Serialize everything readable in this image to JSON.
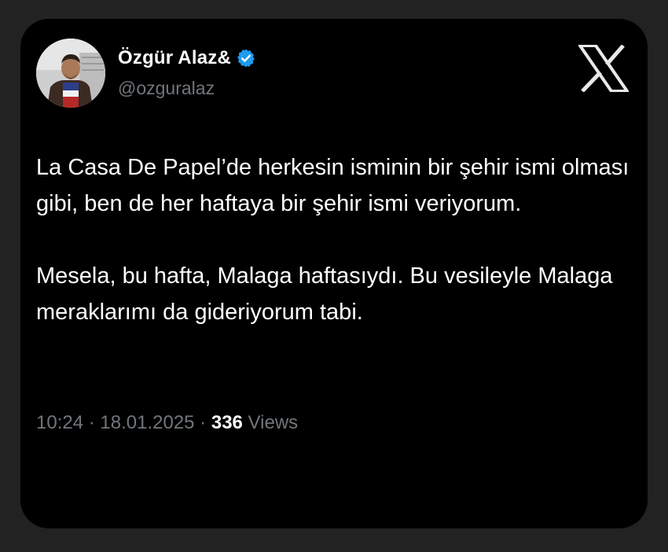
{
  "author": {
    "display_name": "Özgür Alaz&",
    "handle": "@ozguralaz",
    "verified": true,
    "verified_color": "#1d9bf0",
    "avatar_icon": "profile-photo"
  },
  "brand": {
    "logo_icon": "x-logo"
  },
  "tweet": {
    "paragraph_1": "La Casa De Papel’de herkesin isminin bir şehir ismi olması gibi, ben de her haftaya bir şehir ismi veriyorum.",
    "paragraph_2": "Mesela, bu hafta, Malaga haftasıydı. Bu vesileyle Malaga meraklarımı da gideriyorum tabi."
  },
  "meta": {
    "time": "10:24",
    "separator": " · ",
    "date": "18.01.2025",
    "views_count": "336",
    "views_label": " Views"
  },
  "colors": {
    "background": "#222222",
    "card": "#000000",
    "text": "#ffffff",
    "muted": "#71767b"
  }
}
